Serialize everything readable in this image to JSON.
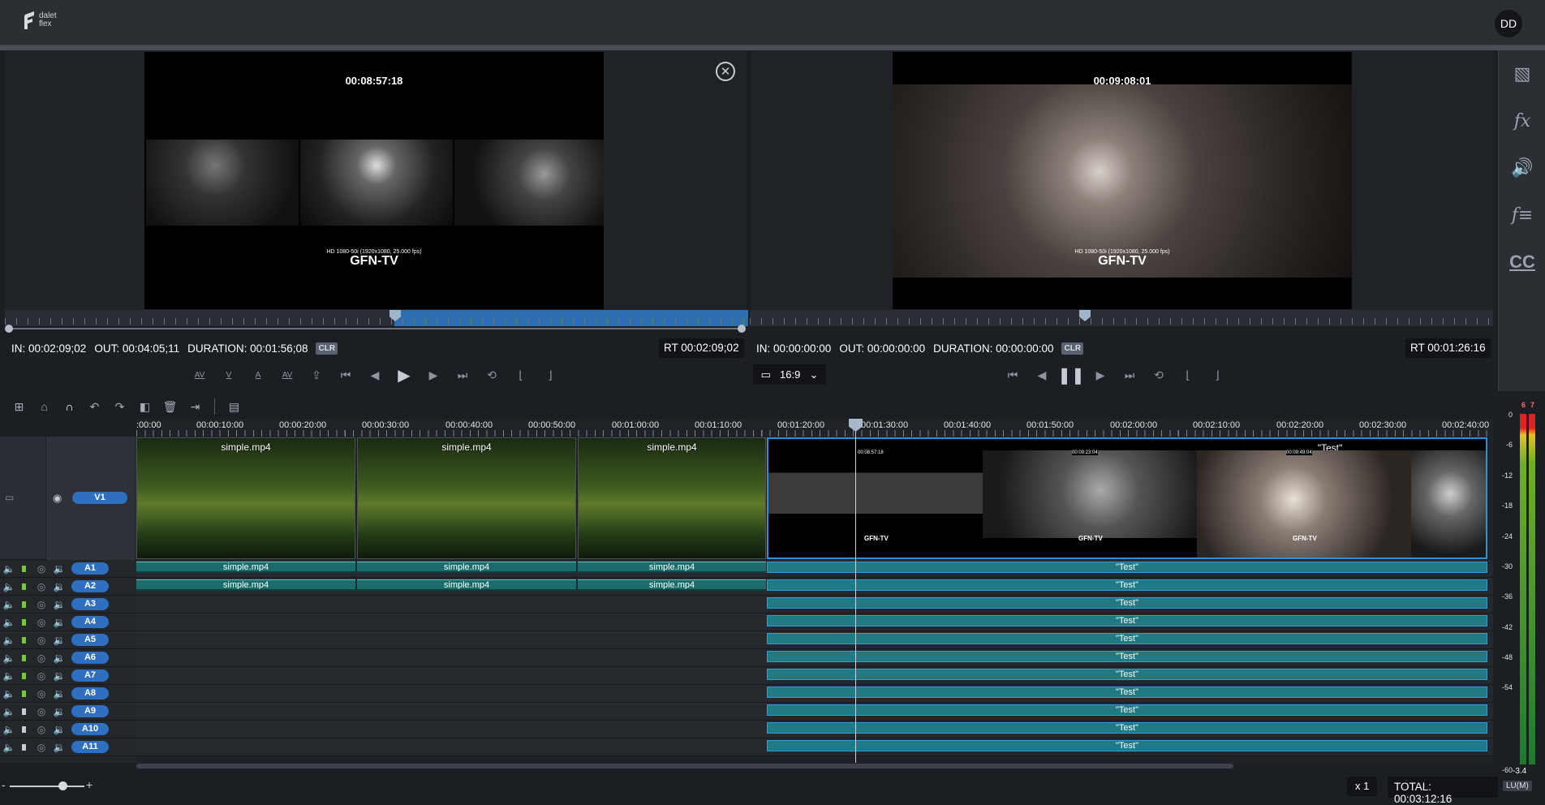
{
  "header": {
    "logo_text_1": "dalet",
    "logo_text_2": "flex",
    "user_initials": "DD"
  },
  "source_monitor": {
    "timecode": "00:08:57:18",
    "format_text": "HD 1080-50i (1920x1080, 25.000 fps)",
    "channel_brand": "GFN-TV",
    "in": "IN: 00:02:09;02",
    "out": "OUT: 00:04:05;11",
    "duration": "DURATION: 00:01:56;08",
    "clr": "CLR",
    "rt": "RT 00:02:09;02"
  },
  "program_monitor": {
    "timecode": "00:09:08:01",
    "format_text": "HD 1080-50i (1920x1080, 25.000 fps)",
    "channel_brand": "GFN-TV",
    "in": "IN: 00:00:00:00",
    "out": "OUT: 00:00:00:00",
    "duration": "DURATION: 00:00:00:00",
    "clr": "CLR",
    "rt": "RT 00:01:26:16",
    "aspect": "16:9"
  },
  "source_transport": [
    "AV",
    "V",
    "A",
    "AV"
  ],
  "ruler_labels": [
    ":00:00",
    "00:00:10:00",
    "00:00:20:00",
    "00:00:30:00",
    "00:00:40:00",
    "00:00:50:00",
    "00:01:00:00",
    "00:01:10:00",
    "00:01:20:00",
    "00:01:30:00",
    "00:01:40:00",
    "00:01:50:00",
    "00:02:00:00",
    "00:02:10:00",
    "00:02:20:00",
    "00:02:30:00",
    "00:02:40:00"
  ],
  "video_track": {
    "label": "V1",
    "clips": [
      "simple.mp4",
      "simple.mp4",
      "simple.mp4"
    ],
    "test_clip": "\"Test\"",
    "test_timecodes": [
      "00:08:57:18",
      "00:09:23:04",
      "00:09:49:04"
    ],
    "test_brand": "GFN-TV"
  },
  "audio_tracks": [
    {
      "label": "A1",
      "clips": [
        "simple.mp4",
        "simple.mp4",
        "simple.mp4"
      ],
      "test": "\"Test\"",
      "active": true
    },
    {
      "label": "A2",
      "clips": [
        "simple.mp4",
        "simple.mp4",
        "simple.mp4"
      ],
      "test": "\"Test\"",
      "active": true
    },
    {
      "label": "A3",
      "clips": [],
      "test": "\"Test\"",
      "active": true
    },
    {
      "label": "A4",
      "clips": [],
      "test": "\"Test\"",
      "active": true
    },
    {
      "label": "A5",
      "clips": [],
      "test": "\"Test\"",
      "active": true
    },
    {
      "label": "A6",
      "clips": [],
      "test": "\"Test\"",
      "active": true
    },
    {
      "label": "A7",
      "clips": [],
      "test": "\"Test\"",
      "active": true
    },
    {
      "label": "A8",
      "clips": [],
      "test": "\"Test\"",
      "active": true
    },
    {
      "label": "A9",
      "clips": [],
      "test": "\"Test\"",
      "active": false
    },
    {
      "label": "A10",
      "clips": [],
      "test": "\"Test\"",
      "active": false
    },
    {
      "label": "A11",
      "clips": [],
      "test": "\"Test\"",
      "active": false
    }
  ],
  "meter": {
    "peak_left": "6",
    "peak_right": "7",
    "scale": [
      "0",
      "-6",
      "-12",
      "-18",
      "-24",
      "-30",
      "-36",
      "-42",
      "-48",
      "-54",
      "-60"
    ],
    "value": "-3.4",
    "unit": "LU(M)"
  },
  "bottom": {
    "zoom_minus": "-",
    "zoom_plus": "+",
    "speed": "x 1",
    "total": "TOTAL: 00:03:12:16"
  },
  "sidebar": [
    "media-icon",
    "fx-icon",
    "audio-icon",
    "fx-list-icon",
    "cc-icon"
  ],
  "colors": {
    "accent": "#2e6fc0",
    "selection": "#2c6fb3",
    "audio_clip": "#1b6b6b"
  }
}
